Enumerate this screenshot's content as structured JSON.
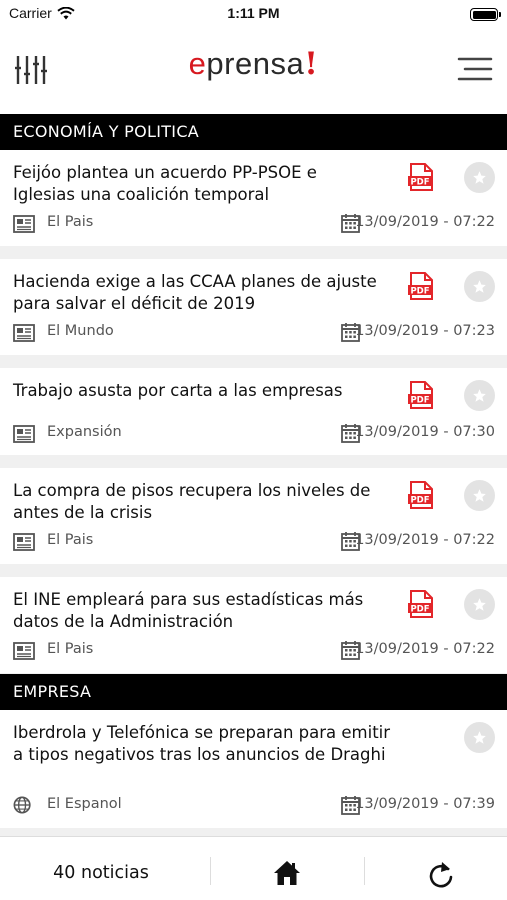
{
  "status_bar": {
    "carrier": "Carrier",
    "time": "1:11 PM"
  },
  "header": {
    "logo_e": "e",
    "logo_rest": "prensa",
    "logo_bang": "!"
  },
  "sections": [
    {
      "title": "ECONOMÍA Y POLITICA"
    },
    {
      "title": "EMPRESA"
    }
  ],
  "articles": [
    {
      "title": "Feijóo plantea un acuerdo PP-PSOE e Iglesias una coalición temporal",
      "source": "El Pais",
      "date": "13/09/2019 - 07:22",
      "pdf": "PDF",
      "source_icon": "newspaper-icon"
    },
    {
      "title": "Hacienda exige a las CCAA planes de ajuste para salvar el déficit de 2019",
      "source": "El Mundo",
      "date": "13/09/2019 - 07:23",
      "pdf": "PDF",
      "source_icon": "newspaper-icon"
    },
    {
      "title": "Trabajo asusta por carta a las empresas",
      "source": "Expansión",
      "date": "13/09/2019 - 07:30",
      "pdf": "PDF",
      "source_icon": "newspaper-icon"
    },
    {
      "title": "La compra de pisos recupera los niveles de antes de la crisis",
      "source": "El Pais",
      "date": "13/09/2019 - 07:22",
      "pdf": "PDF",
      "source_icon": "newspaper-icon"
    },
    {
      "title": "El INE empleará para sus estadísticas más datos de la Administración",
      "source": "El Pais",
      "date": "13/09/2019 - 07:22",
      "pdf": "PDF",
      "source_icon": "newspaper-icon"
    },
    {
      "title": "Iberdrola y Telefónica se preparan para emitir a tipos negativos tras los anuncios de Draghi",
      "source": "El Espanol",
      "date": "13/09/2019 - 07:39",
      "source_icon": "globe-icon"
    }
  ],
  "bottom_bar": {
    "count": "40 noticias"
  },
  "colors": {
    "accent": "#d71920",
    "section_bg": "#000000",
    "background": "#f0f0f0"
  }
}
